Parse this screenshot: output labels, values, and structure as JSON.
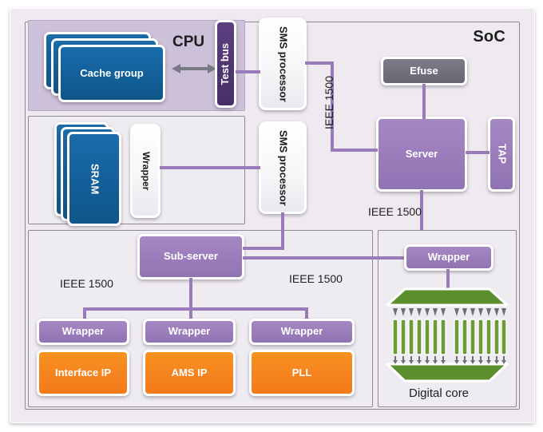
{
  "diagram": {
    "title": "SoC",
    "cpu_label": "CPU",
    "blocks": {
      "cache_group": "Cache group",
      "test_bus": "Test bus",
      "sms_processor_top": "SMS processor",
      "sms_processor_mid": "SMS processor",
      "efuse": "Efuse",
      "server": "Server",
      "tap": "TAP",
      "sram": "SRAM",
      "sram_wrapper": "Wrapper",
      "sub_server": "Sub-server",
      "wrapper_interface": "Wrapper",
      "wrapper_ams": "Wrapper",
      "wrapper_pll": "Wrapper",
      "interface_ip": "Interface IP",
      "ams_ip": "AMS IP",
      "pll": "PLL",
      "core_wrapper": "Wrapper",
      "digital_core": "Digital core"
    },
    "bus_labels": {
      "ieee_vertical": "IEEE 1500",
      "ieee_server_to_core": "IEEE 1500",
      "ieee_subserver_left": "IEEE 1500",
      "ieee_subserver_right": "IEEE 1500"
    },
    "colors": {
      "soc_background": "#eeeaf0",
      "cpu_panel": "#cdc1da",
      "memory_blue": "#125f99",
      "bus_purple": "#9a7bba",
      "test_bus_purple": "#4e3570",
      "efuse_gray": "#6f6f7c",
      "ip_orange": "#f58220",
      "scan_green": "#5b8f2e",
      "frame_border": "#8d8896"
    },
    "scan_chains": {
      "left_group_count": 8,
      "right_group_count": 8
    }
  }
}
